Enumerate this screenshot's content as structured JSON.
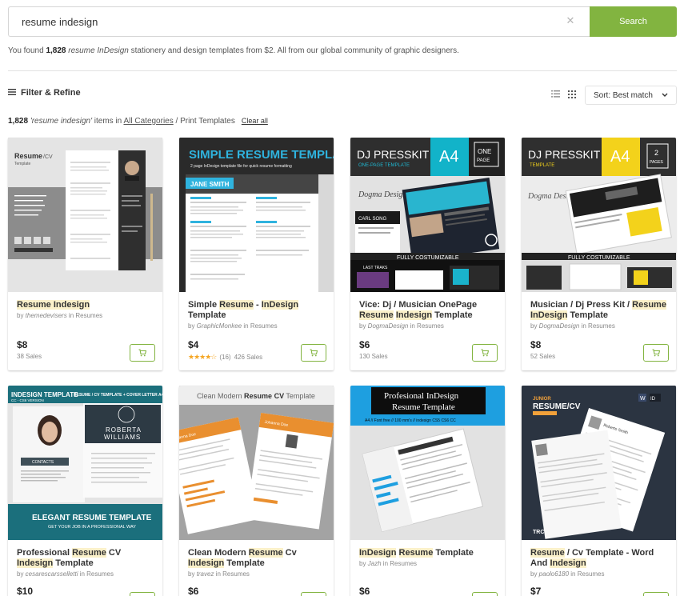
{
  "search": {
    "value": "resume indesign",
    "button_label": "Search",
    "clear_icon": "close-icon"
  },
  "found": {
    "prefix": "You found ",
    "count": "1,828",
    "query": "resume InDesign",
    "suffix": " stationery and design templates from $2. All from our global community of graphic designers."
  },
  "filter": {
    "label": "Filter & Refine"
  },
  "sort": {
    "label": "Sort: Best match"
  },
  "breadcrumb": {
    "count": "1,828",
    "query": "'resume indesign'",
    "middle": " items in ",
    "category": "All Categories",
    "separator": " / Print Templates",
    "clear": "Clear all"
  },
  "cards": [
    {
      "title_parts": [
        {
          "text": "Resume Indesign",
          "hl": true
        }
      ],
      "author": "themedevisers",
      "category": "Resumes",
      "price": "$8",
      "sales": "38 Sales",
      "thumb": {
        "name": "Resume/CV",
        "sub": "Template"
      }
    },
    {
      "title_parts": [
        {
          "text": "Simple ",
          "hl": false
        },
        {
          "text": "Resume",
          "hl": true
        },
        {
          "text": " - ",
          "hl": false
        },
        {
          "text": "InDesign",
          "hl": true
        },
        {
          "text": " Template",
          "hl": false
        }
      ],
      "author": "GraphicMonkee",
      "category": "Resumes",
      "price": "$4",
      "rating_count": "(16)",
      "sales": "426 Sales",
      "stars": "★★★★☆",
      "thumb": {
        "headline": "SIMPLE RESUME TEMPLATE",
        "sub": "2 page InDesign template file for quick resume formatting",
        "name": "JANE SMITH"
      }
    },
    {
      "title_parts": [
        {
          "text": "Vice: Dj / Musician OnePage ",
          "hl": false
        },
        {
          "text": "Resume",
          "hl": true
        },
        {
          "text": " ",
          "hl": false
        },
        {
          "text": "Indesign",
          "hl": true
        },
        {
          "text": " Template",
          "hl": false
        }
      ],
      "author": "DogmaDesign",
      "category": "Resumes",
      "price": "$6",
      "sales": "130 Sales",
      "thumb": {
        "headline": "DJ PRESSKIT",
        "size": "A4",
        "pages": "ONE PAGE",
        "sub": "ONE-PAGE TEMPLATE",
        "brand": "Dogma Design",
        "badge": "FULLY COSTUMIZABLE",
        "tag": "LAST TRAKS",
        "name": "CARL SONG"
      }
    },
    {
      "title_parts": [
        {
          "text": "Musician / Dj Press Kit / ",
          "hl": false
        },
        {
          "text": "Resume",
          "hl": true
        },
        {
          "text": " ",
          "hl": false
        },
        {
          "text": "InDesign",
          "hl": true
        },
        {
          "text": " Template",
          "hl": false
        }
      ],
      "author": "DogmaDesign",
      "category": "Resumes",
      "price": "$8",
      "sales": "52 Sales",
      "thumb": {
        "headline": "DJ PRESSKIT",
        "sub": "TEMPLATE",
        "size": "A4",
        "pages": "2 PAGES",
        "brand": "Dogma Design",
        "badge": "FULLY COSTUMIZABLE"
      }
    },
    {
      "title_parts": [
        {
          "text": "Professional ",
          "hl": false
        },
        {
          "text": "Resume",
          "hl": true
        },
        {
          "text": " CV ",
          "hl": false
        },
        {
          "text": "Indesign",
          "hl": true
        },
        {
          "text": " Template",
          "hl": false
        }
      ],
      "author": "cesarescarsselletti",
      "category": "Resumes",
      "price": "$10",
      "thumb": {
        "headline": "INDESIGN TEMPLATE RESUME / CV TEMPLATE + COVER LETTER A4",
        "sub2": "CC - CS6 VERSION",
        "name1": "ROBERTA",
        "name2": "WILLIAMS",
        "foot": "ELEGANT RESUME TEMPLATE",
        "foot2": "GET YOUR JOB IN A PROFESSIONAL WAY",
        "contacts": "CONTACTS"
      }
    },
    {
      "title_parts": [
        {
          "text": "Clean Modern ",
          "hl": false
        },
        {
          "text": "Resume",
          "hl": true
        },
        {
          "text": " Cv ",
          "hl": false
        },
        {
          "text": "Indesign",
          "hl": true
        },
        {
          "text": " Template",
          "hl": false
        }
      ],
      "author": "travez",
      "category": "Resumes",
      "price": "$6",
      "thumb": {
        "pre": "Clean Modern ",
        "mid": "Resume CV",
        "post": " Template",
        "name": "Johanna Doe",
        "role": "Creative Designer"
      }
    },
    {
      "title_parts": [
        {
          "text": "InDesign",
          "hl": true
        },
        {
          "text": " ",
          "hl": false
        },
        {
          "text": "Resume",
          "hl": true
        },
        {
          "text": " Template",
          "hl": false
        }
      ],
      "author": "Jazh",
      "category": "Resumes",
      "price": "$6",
      "thumb": {
        "line1": "Profesional InDesign",
        "line2": "Resume Template",
        "sub": "A4 // Font free // 100 mm's // indesign CS5 CS6 CC"
      }
    },
    {
      "title_parts": [
        {
          "text": "Resume",
          "hl": true
        },
        {
          "text": " / Cv Template - Word And ",
          "hl": false
        },
        {
          "text": "Indesign",
          "hl": true
        }
      ],
      "author": "paolo6180",
      "category": "Resumes",
      "price": "$7",
      "thumb": {
        "line1": "JUNIOR",
        "line2": "RESUME/CV",
        "line3": "VOLUME 1",
        "brand": "TRC",
        "name": "Roberto Smith",
        "wm": "envato"
      }
    }
  ],
  "by_label": "by ",
  "in_label": " in "
}
